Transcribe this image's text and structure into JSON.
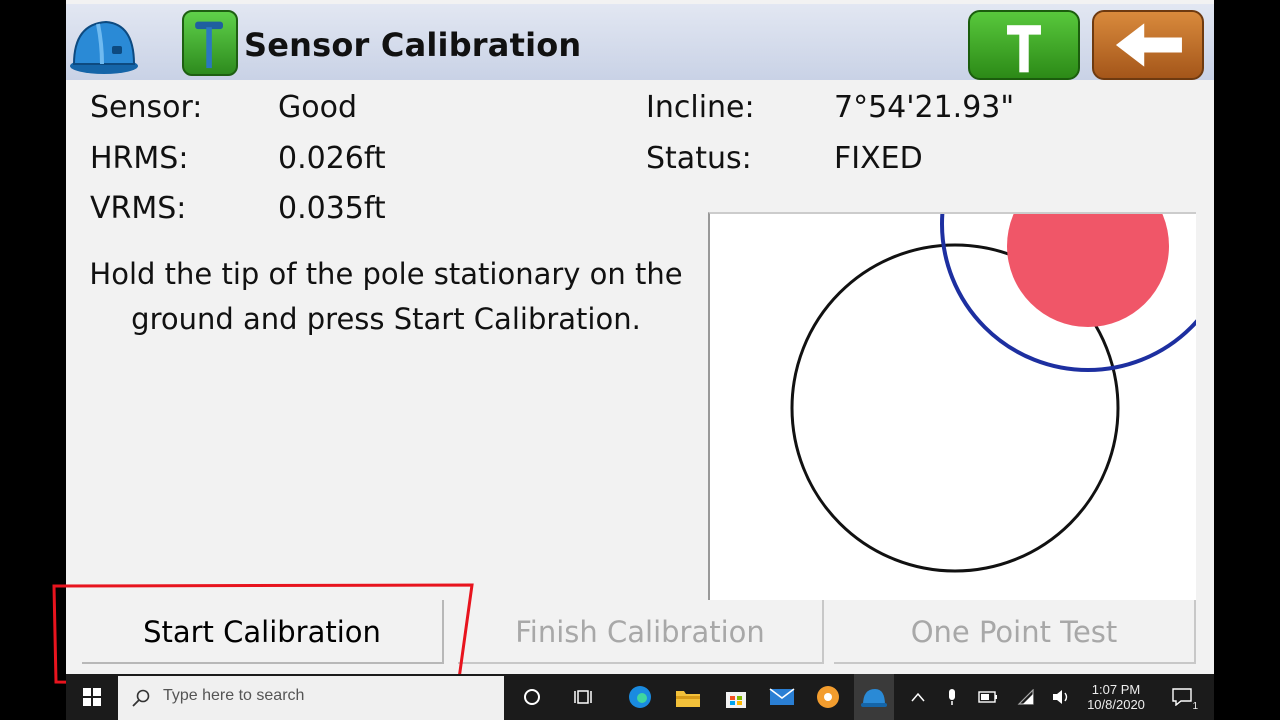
{
  "header": {
    "title": "Sensor Calibration"
  },
  "readings": {
    "sensor_label": "Sensor:",
    "sensor_value": "Good",
    "hrms_label": "HRMS:",
    "hrms_value": "0.026ft",
    "vrms_label": "VRMS:",
    "vrms_value": "0.035ft",
    "incline_label": "Incline:",
    "incline_value": "7°54'21.93\"",
    "status_label": "Status:",
    "status_value": "FIXED"
  },
  "instruction": "Hold the tip of the pole stationary on the ground and press Start Calibration.",
  "buttons": {
    "start": "Start Calibration",
    "finish": "Finish Calibration",
    "one_point": "One Point Test"
  },
  "taskbar": {
    "search_placeholder": "Type here to search",
    "time": "1:07 PM",
    "date": "10/8/2020",
    "notifications": "1"
  },
  "colors": {
    "bubble": "#f05668",
    "tolerance_ring": "#1d2fa0",
    "highlight": "#e8141e"
  }
}
